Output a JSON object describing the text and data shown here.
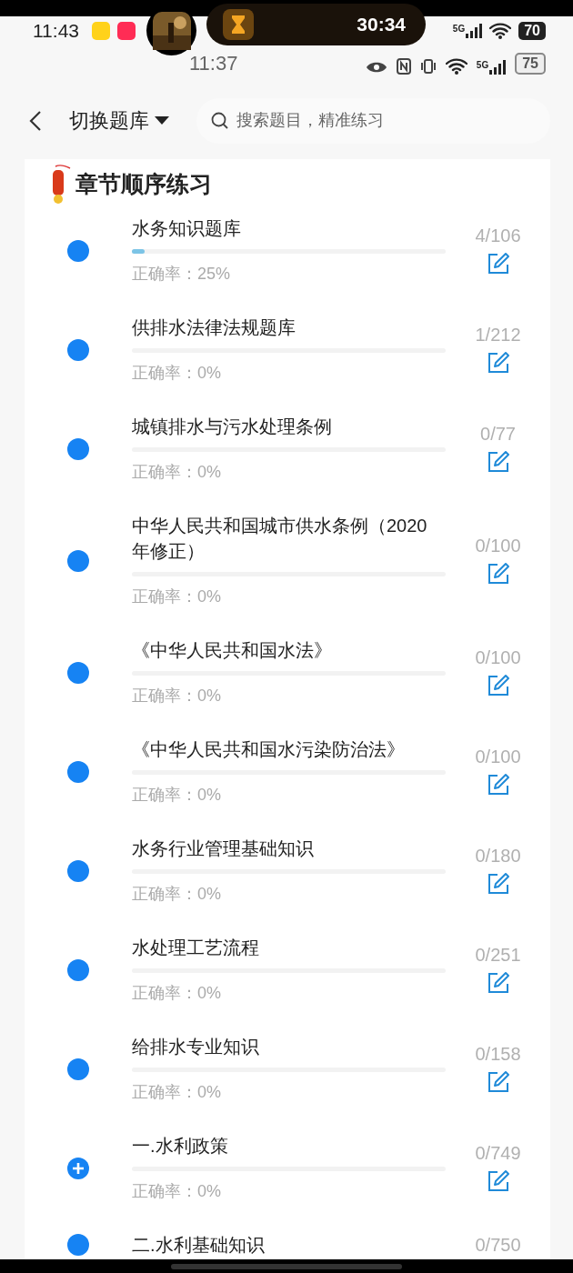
{
  "status_bar": {
    "time": "11:43",
    "timer": "30:34",
    "network": "5G",
    "battery": "70"
  },
  "status_bar_2": {
    "time": "11:37",
    "network": "5G",
    "battery": "75"
  },
  "header": {
    "bank_switch": "切换题库",
    "search": {
      "placeholder": "搜索题目，精准练习"
    }
  },
  "section": {
    "title": "章节顺序练习"
  },
  "chapters": [
    {
      "kind": "dot",
      "title": "水务知识题库",
      "level": 0.04,
      "accuracy": "正确率：25%",
      "count": "4/106"
    },
    {
      "kind": "dot",
      "title": "供排水法律法规题库",
      "accuracy": "正确率：0%",
      "count": "1/212"
    },
    {
      "kind": "dot",
      "title": "城镇排水与污水处理条例",
      "accuracy": "正确率：0%",
      "count": "0/77"
    },
    {
      "kind": "dot",
      "title": "中华人民共和国城市供水条例（2020 年修正）",
      "accuracy": "正确率：0%",
      "count": "0/100"
    },
    {
      "kind": "dot",
      "title": "《中华人民共和国水法》",
      "accuracy": "正确率：0%",
      "count": "0/100"
    },
    {
      "kind": "dot",
      "title": "《中华人民共和国水污染防治法》",
      "accuracy": "正确率：0%",
      "count": "0/100"
    },
    {
      "kind": "dot",
      "title": "水务行业管理基础知识",
      "accuracy": "正确率：0%",
      "count": "0/180"
    },
    {
      "kind": "dot",
      "title": "水处理工艺流程",
      "accuracy": "正确率：0%",
      "count": "0/251"
    },
    {
      "kind": "dot",
      "title": "给排水专业知识",
      "accuracy": "正确率：0%",
      "count": "0/158"
    },
    {
      "kind": "plus",
      "title": "一.水利政策",
      "accuracy": "正确率：0%",
      "count": "0/749"
    },
    {
      "kind": "dot",
      "title": "二.水利基础知识",
      "count": "0/750"
    }
  ]
}
